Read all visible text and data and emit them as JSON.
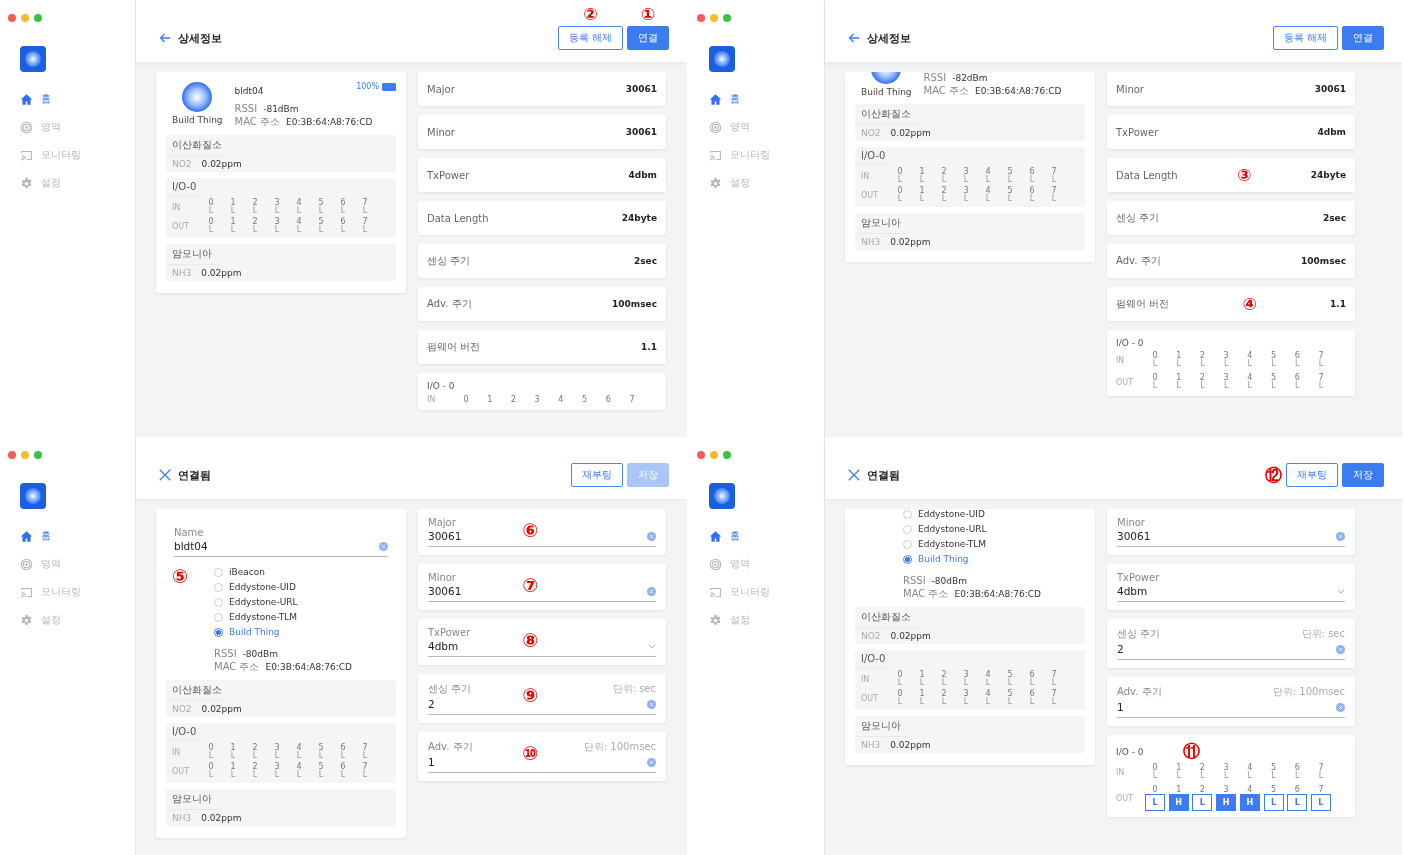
{
  "panels": [
    {
      "sidebar": [
        {
          "label": "홈",
          "selected": true
        },
        {
          "label": "영역",
          "selected": false
        },
        {
          "label": "모니터링",
          "selected": false
        },
        {
          "label": "설정",
          "selected": false
        }
      ],
      "header": {
        "kind": "view",
        "title": "상세정보",
        "buttons": [
          {
            "label": "등록 해제",
            "kind": "outline",
            "disabled": false,
            "marker": "②"
          },
          {
            "label": "연결",
            "kind": "primary",
            "disabled": false,
            "marker": "①"
          }
        ]
      },
      "device": {
        "cropped": false,
        "battery": {
          "text": "100%",
          "level": 1
        },
        "name": "bldt04",
        "avatar_label": "Build Thing",
        "rssi": {
          "label": "RSSI",
          "value": "-81dBm"
        },
        "mac": {
          "label": "MAC 주소",
          "value": "E0:3B:64:A8:76:CD"
        },
        "sensors": [
          {
            "kind": "reading",
            "title": "이산화질소",
            "key": "NO2",
            "value": "0.02ppm"
          },
          {
            "kind": "io",
            "title": "I/O-0",
            "rows": [
              {
                "label": "IN",
                "kind": "display",
                "pins": [
                  {
                    "index": "0",
                    "value": "L"
                  },
                  {
                    "index": "1",
                    "value": "L"
                  },
                  {
                    "index": "2",
                    "value": "L"
                  },
                  {
                    "index": "3",
                    "value": "L"
                  },
                  {
                    "index": "4",
                    "value": "L"
                  },
                  {
                    "index": "5",
                    "value": "L"
                  },
                  {
                    "index": "6",
                    "value": "L"
                  },
                  {
                    "index": "7",
                    "value": "L"
                  }
                ]
              },
              {
                "label": "OUT",
                "kind": "display",
                "pins": [
                  {
                    "index": "0",
                    "value": "L"
                  },
                  {
                    "index": "1",
                    "value": "L"
                  },
                  {
                    "index": "2",
                    "value": "L"
                  },
                  {
                    "index": "3",
                    "value": "L"
                  },
                  {
                    "index": "4",
                    "value": "L"
                  },
                  {
                    "index": "5",
                    "value": "L"
                  },
                  {
                    "index": "6",
                    "value": "L"
                  },
                  {
                    "index": "7",
                    "value": "L"
                  }
                ]
              }
            ]
          },
          {
            "kind": "reading",
            "title": "암모니아",
            "key": "NH3",
            "value": "0.02ppm"
          }
        ]
      },
      "details": [
        {
          "kind": "info",
          "label": "Major",
          "value": "30061"
        },
        {
          "kind": "info",
          "label": "Minor",
          "value": "30061"
        },
        {
          "kind": "info",
          "label": "TxPower",
          "value": "4dbm"
        },
        {
          "kind": "info",
          "label": "Data Length",
          "value": "24byte"
        },
        {
          "kind": "info",
          "label": "센싱 주기",
          "value": "2sec"
        },
        {
          "kind": "info",
          "label": "Adv. 주기",
          "value": "100msec"
        },
        {
          "kind": "info",
          "label": "펌웨어 버전",
          "value": "1.1"
        },
        {
          "kind": "io",
          "title": "I/O - 0",
          "rows": [
            {
              "label": "IN",
              "kind": "display",
              "pins": [
                {
                  "index": "0"
                },
                {
                  "index": "1"
                },
                {
                  "index": "2"
                },
                {
                  "index": "3"
                },
                {
                  "index": "4"
                },
                {
                  "index": "5"
                },
                {
                  "index": "6"
                },
                {
                  "index": "7"
                }
              ]
            }
          ]
        }
      ]
    },
    {
      "sidebar": [
        {
          "label": "홈",
          "selected": true
        },
        {
          "label": "영역",
          "selected": false
        },
        {
          "label": "모니터링",
          "selected": false
        },
        {
          "label": "설정",
          "selected": false
        }
      ],
      "header": {
        "kind": "view",
        "title": "상세정보",
        "buttons": [
          {
            "label": "등록 해제",
            "kind": "outline",
            "disabled": false
          },
          {
            "label": "연결",
            "kind": "primary",
            "disabled": false
          }
        ]
      },
      "device": {
        "cropped": true,
        "avatar_label": "Build Thing",
        "rssi": {
          "label": "RSSI",
          "value": "-82dBm"
        },
        "mac": {
          "label": "MAC 주소",
          "value": "E0:3B:64:A8:76:CD"
        },
        "sensors": [
          {
            "kind": "reading",
            "title": "이산화질소",
            "key": "NO2",
            "value": "0.02ppm"
          },
          {
            "kind": "io",
            "title": "I/O-0",
            "rows": [
              {
                "label": "IN",
                "kind": "display",
                "pins": [
                  {
                    "index": "0",
                    "value": "L"
                  },
                  {
                    "index": "1",
                    "value": "L"
                  },
                  {
                    "index": "2",
                    "value": "L"
                  },
                  {
                    "index": "3",
                    "value": "L"
                  },
                  {
                    "index": "4",
                    "value": "L"
                  },
                  {
                    "index": "5",
                    "value": "L"
                  },
                  {
                    "index": "6",
                    "value": "L"
                  },
                  {
                    "index": "7",
                    "value": "L"
                  }
                ]
              },
              {
                "label": "OUT",
                "kind": "display",
                "pins": [
                  {
                    "index": "0",
                    "value": "L"
                  },
                  {
                    "index": "1",
                    "value": "L"
                  },
                  {
                    "index": "2",
                    "value": "L"
                  },
                  {
                    "index": "3",
                    "value": "L"
                  },
                  {
                    "index": "4",
                    "value": "L"
                  },
                  {
                    "index": "5",
                    "value": "L"
                  },
                  {
                    "index": "6",
                    "value": "L"
                  },
                  {
                    "index": "7",
                    "value": "L"
                  }
                ]
              }
            ]
          },
          {
            "kind": "reading",
            "title": "암모니아",
            "key": "NH3",
            "value": "0.02ppm"
          }
        ]
      },
      "details": [
        {
          "kind": "info",
          "label": "Minor",
          "value": "30061"
        },
        {
          "kind": "info",
          "label": "TxPower",
          "value": "4dbm"
        },
        {
          "kind": "info",
          "label": "Data Length",
          "value": "24byte",
          "marker": "③"
        },
        {
          "kind": "info",
          "label": "센싱 주기",
          "value": "2sec"
        },
        {
          "kind": "info",
          "label": "Adv. 주기",
          "value": "100msec"
        },
        {
          "kind": "info",
          "label": "펌웨어 버전",
          "value": "1.1",
          "marker": "④"
        },
        {
          "kind": "io",
          "title": "I/O - 0",
          "rows": [
            {
              "label": "IN",
              "kind": "display",
              "pins": [
                {
                  "index": "0",
                  "value": "L"
                },
                {
                  "index": "1",
                  "value": "L"
                },
                {
                  "index": "2",
                  "value": "L"
                },
                {
                  "index": "3",
                  "value": "L"
                },
                {
                  "index": "4",
                  "value": "L"
                },
                {
                  "index": "5",
                  "value": "L"
                },
                {
                  "index": "6",
                  "value": "L"
                },
                {
                  "index": "7",
                  "value": "L"
                }
              ]
            },
            {
              "label": "OUT",
              "kind": "display",
              "pins": [
                {
                  "index": "0",
                  "value": "L"
                },
                {
                  "index": "1",
                  "value": "L"
                },
                {
                  "index": "2",
                  "value": "L"
                },
                {
                  "index": "3",
                  "value": "L"
                },
                {
                  "index": "4",
                  "value": "L"
                },
                {
                  "index": "5",
                  "value": "L"
                },
                {
                  "index": "6",
                  "value": "L"
                },
                {
                  "index": "7",
                  "value": "L"
                }
              ]
            }
          ]
        }
      ]
    },
    {
      "sidebar": [
        {
          "label": "홈",
          "selected": true
        },
        {
          "label": "영역",
          "selected": false
        },
        {
          "label": "모니터링",
          "selected": false
        },
        {
          "label": "설정",
          "selected": false
        }
      ],
      "header": {
        "kind": "edit",
        "title": "연결됨",
        "buttons": [
          {
            "label": "재부팅",
            "kind": "outline",
            "disabled": false
          },
          {
            "label": "저장",
            "kind": "primary",
            "disabled": true
          }
        ]
      },
      "device": {
        "cropped": false,
        "name_field": {
          "label": "Name",
          "value": "bldt04"
        },
        "types_marker": "⑤",
        "beacon_types": [
          {
            "label": "iBeacon",
            "selected": false
          },
          {
            "label": "Eddystone-UID",
            "selected": false
          },
          {
            "label": "Eddystone-URL",
            "selected": false
          },
          {
            "label": "Eddystone-TLM",
            "selected": false
          },
          {
            "label": "Build Thing",
            "selected": true
          }
        ],
        "rssi": {
          "label": "RSSI",
          "value": "-80dBm"
        },
        "mac": {
          "label": "MAC 주소",
          "value": "E0:3B:64:A8:76:CD"
        },
        "sensors": [
          {
            "kind": "reading",
            "title": "이산화질소",
            "key": "NO2",
            "value": "0.02ppm"
          },
          {
            "kind": "io",
            "title": "I/O-0",
            "rows": [
              {
                "label": "IN",
                "kind": "display",
                "pins": [
                  {
                    "index": "0",
                    "value": "L"
                  },
                  {
                    "index": "1",
                    "value": "L"
                  },
                  {
                    "index": "2",
                    "value": "L"
                  },
                  {
                    "index": "3",
                    "value": "L"
                  },
                  {
                    "index": "4",
                    "value": "L"
                  },
                  {
                    "index": "5",
                    "value": "L"
                  },
                  {
                    "index": "6",
                    "value": "L"
                  },
                  {
                    "index": "7",
                    "value": "L"
                  }
                ]
              },
              {
                "label": "OUT",
                "kind": "display",
                "pins": [
                  {
                    "index": "0",
                    "value": "L"
                  },
                  {
                    "index": "1",
                    "value": "L"
                  },
                  {
                    "index": "2",
                    "value": "L"
                  },
                  {
                    "index": "3",
                    "value": "L"
                  },
                  {
                    "index": "4",
                    "value": "L"
                  },
                  {
                    "index": "5",
                    "value": "L"
                  },
                  {
                    "index": "6",
                    "value": "L"
                  },
                  {
                    "index": "7",
                    "value": "L"
                  }
                ]
              }
            ]
          },
          {
            "kind": "reading",
            "title": "암모니아",
            "key": "NH3",
            "value": "0.02ppm"
          }
        ]
      },
      "details": [
        {
          "kind": "field",
          "label": "Major",
          "value": "30061",
          "marker": "⑥"
        },
        {
          "kind": "field",
          "label": "Minor",
          "value": "30061",
          "marker": "⑦"
        },
        {
          "kind": "select",
          "label": "TxPower",
          "value": "4dbm",
          "marker": "⑧"
        },
        {
          "kind": "field",
          "label": "센싱 주기",
          "value": "2",
          "unit": "단위: sec",
          "marker": "⑨"
        },
        {
          "kind": "field",
          "label": "Adv. 주기",
          "value": "1",
          "unit": "단위: 100msec",
          "marker": "⑩"
        }
      ]
    },
    {
      "sidebar": [
        {
          "label": "홈",
          "selected": true
        },
        {
          "label": "영역",
          "selected": false
        },
        {
          "label": "모니터링",
          "selected": false
        },
        {
          "label": "설정",
          "selected": false
        }
      ],
      "header": {
        "kind": "edit",
        "title": "연결됨",
        "marker": "⑫",
        "buttons": [
          {
            "label": "재부팅",
            "kind": "outline",
            "disabled": false
          },
          {
            "label": "저장",
            "kind": "primary",
            "disabled": false
          }
        ]
      },
      "device": {
        "cropped": true,
        "beacon_types": [
          {
            "label": "Eddystone-UID",
            "selected": false
          },
          {
            "label": "Eddystone-URL",
            "selected": false
          },
          {
            "label": "Eddystone-TLM",
            "selected": false
          },
          {
            "label": "Build Thing",
            "selected": true
          }
        ],
        "rssi": {
          "label": "RSSI",
          "value": "-80dBm"
        },
        "mac": {
          "label": "MAC 주소",
          "value": "E0:3B:64:A8:76:CD"
        },
        "sensors": [
          {
            "kind": "reading",
            "title": "이산화질소",
            "key": "NO2",
            "value": "0.02ppm"
          },
          {
            "kind": "io",
            "title": "I/O-0",
            "rows": [
              {
                "label": "IN",
                "kind": "display",
                "pins": [
                  {
                    "index": "0",
                    "value": "L"
                  },
                  {
                    "index": "1",
                    "value": "L"
                  },
                  {
                    "index": "2",
                    "value": "L"
                  },
                  {
                    "index": "3",
                    "value": "L"
                  },
                  {
                    "index": "4",
                    "value": "L"
                  },
                  {
                    "index": "5",
                    "value": "L"
                  },
                  {
                    "index": "6",
                    "value": "L"
                  },
                  {
                    "index": "7",
                    "value": "L"
                  }
                ]
              },
              {
                "label": "OUT",
                "kind": "display",
                "pins": [
                  {
                    "index": "0",
                    "value": "L"
                  },
                  {
                    "index": "1",
                    "value": "L"
                  },
                  {
                    "index": "2",
                    "value": "L"
                  },
                  {
                    "index": "3",
                    "value": "L"
                  },
                  {
                    "index": "4",
                    "value": "L"
                  },
                  {
                    "index": "5",
                    "value": "L"
                  },
                  {
                    "index": "6",
                    "value": "L"
                  },
                  {
                    "index": "7",
                    "value": "L"
                  }
                ]
              }
            ]
          },
          {
            "kind": "reading",
            "title": "암모니아",
            "key": "NH3",
            "value": "0.02ppm"
          }
        ]
      },
      "details": [
        {
          "kind": "field",
          "label": "Minor",
          "value": "30061"
        },
        {
          "kind": "select",
          "label": "TxPower",
          "value": "4dbm"
        },
        {
          "kind": "field",
          "label": "센싱 주기",
          "value": "2",
          "unit": "단위: sec"
        },
        {
          "kind": "field",
          "label": "Adv. 주기",
          "value": "1",
          "unit": "단위: 100msec"
        },
        {
          "kind": "io",
          "title": "I/O - 0",
          "marker": "⑪",
          "rows": [
            {
              "label": "IN",
              "kind": "display",
              "pins": [
                {
                  "index": "0",
                  "value": "L"
                },
                {
                  "index": "1",
                  "value": "L"
                },
                {
                  "index": "2",
                  "value": "L"
                },
                {
                  "index": "3",
                  "value": "L"
                },
                {
                  "index": "4",
                  "value": "L"
                },
                {
                  "index": "5",
                  "value": "L"
                },
                {
                  "index": "6",
                  "value": "L"
                },
                {
                  "index": "7",
                  "value": "L"
                }
              ]
            },
            {
              "label": "OUT",
              "kind": "toggle",
              "pins": [
                {
                  "index": "0",
                  "value": "L",
                  "on": false
                },
                {
                  "index": "1",
                  "value": "H",
                  "on": true
                },
                {
                  "index": "2",
                  "value": "L",
                  "on": false
                },
                {
                  "index": "3",
                  "value": "H",
                  "on": true
                },
                {
                  "index": "4",
                  "value": "H",
                  "on": true
                },
                {
                  "index": "5",
                  "value": "L",
                  "on": false
                },
                {
                  "index": "6",
                  "value": "L",
                  "on": false
                },
                {
                  "index": "7",
                  "value": "L",
                  "on": false
                }
              ]
            }
          ]
        }
      ]
    }
  ]
}
